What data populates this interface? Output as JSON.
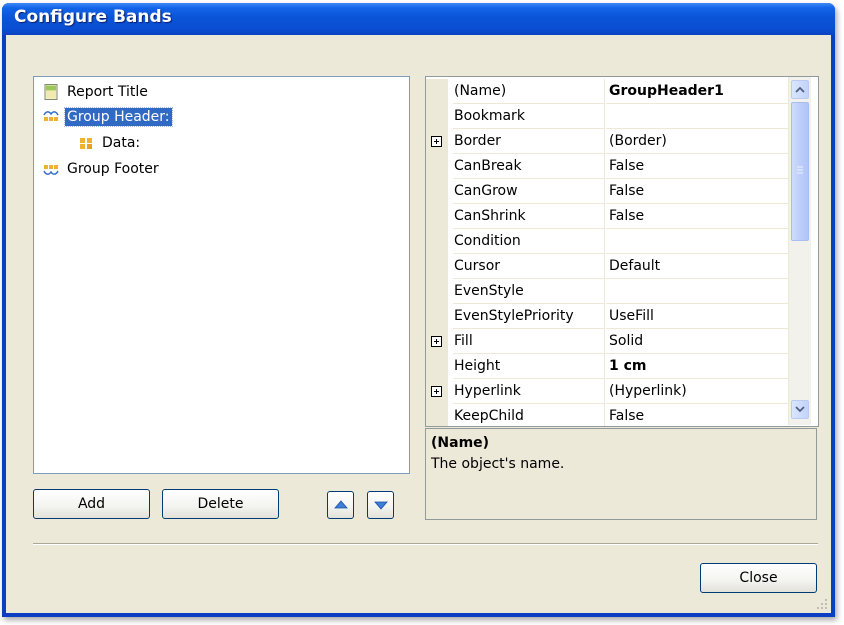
{
  "window": {
    "title": "Configure Bands"
  },
  "tree": {
    "items": [
      {
        "label": "Report Title",
        "icon": "report-title-icon"
      },
      {
        "label": "Group Header:",
        "icon": "group-header-icon",
        "selected": true
      },
      {
        "label": "Data:",
        "icon": "data-band-icon"
      },
      {
        "label": "Group Footer",
        "icon": "group-footer-icon"
      }
    ]
  },
  "buttons": {
    "add": "Add",
    "delete": "Delete",
    "move_up_icon": "arrow-up-icon",
    "move_down_icon": "arrow-down-icon",
    "close": "Close"
  },
  "properties": {
    "rows": [
      {
        "name": "(Name)",
        "value": "GroupHeader1",
        "value_bold": true
      },
      {
        "name": "Bookmark",
        "value": ""
      },
      {
        "name": "Border",
        "value": "(Border)",
        "expandable": true
      },
      {
        "name": "CanBreak",
        "value": "False"
      },
      {
        "name": "CanGrow",
        "value": "False"
      },
      {
        "name": "CanShrink",
        "value": "False"
      },
      {
        "name": "Condition",
        "value": ""
      },
      {
        "name": "Cursor",
        "value": "Default"
      },
      {
        "name": "EvenStyle",
        "value": ""
      },
      {
        "name": "EvenStylePriority",
        "value": "UseFill"
      },
      {
        "name": "Fill",
        "value": "Solid",
        "expandable": true
      },
      {
        "name": "Height",
        "value": "1 cm",
        "value_bold": true
      },
      {
        "name": "Hyperlink",
        "value": "(Hyperlink)",
        "expandable": true
      },
      {
        "name": "KeepChild",
        "value": "False"
      }
    ]
  },
  "description": {
    "title": "(Name)",
    "text": "The object's name."
  },
  "colors": {
    "selection": "#316ac5",
    "dialog_bg": "#ece9d8",
    "titlebar": "#0a54d8"
  }
}
